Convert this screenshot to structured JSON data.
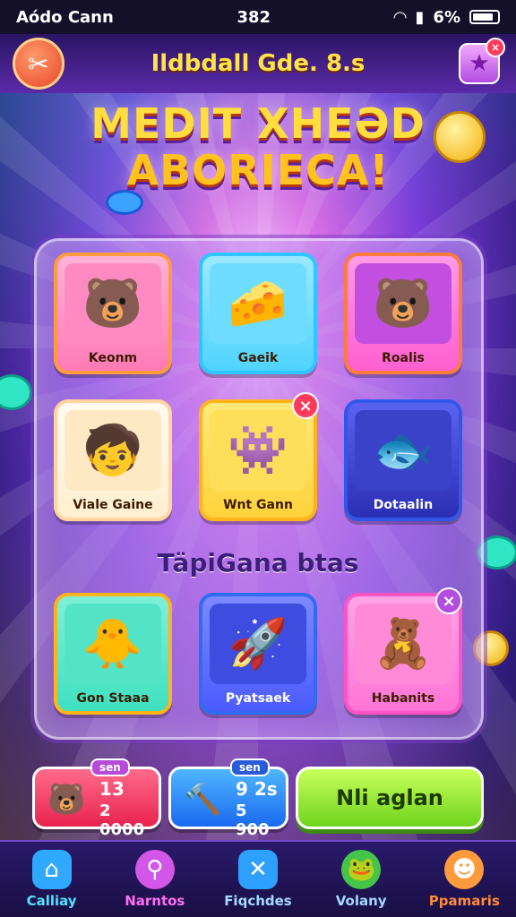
{
  "status_bar": {
    "carrier": "Aódo Cann",
    "time": "382",
    "battery": "6%"
  },
  "header": {
    "title": "Ildbdall Gde. 8.s"
  },
  "hero_title": {
    "line1": "MEDIT XHEƏD",
    "line2": "ABORIECA!"
  },
  "grid_top": [
    {
      "label": "Keonm",
      "icon": "sunglasses-bear-icon",
      "bg": "#ff7ab6",
      "border": "#ff9a3d"
    },
    {
      "label": "Gaeik",
      "icon": "cheese-cake-icon",
      "bg": "#4fd4ff",
      "border": "#2ec6ff"
    },
    {
      "label": "Roalis",
      "icon": "bear-chef-icon",
      "bg": "#ff5fd0",
      "border": "#ff7a3d"
    },
    {
      "label": "Viale Gaine",
      "icon": "helmet-kid-icon",
      "bg": "#fff6e0",
      "border": "#ffd4a0"
    },
    {
      "label": "Wnt Gann",
      "icon": "pink-monster-icon",
      "bg": "#ffd23a",
      "border": "#ffb31a"
    },
    {
      "label": "Dotaalin",
      "icon": "golden-fish-icon",
      "bg": "#3b3fd1",
      "border": "#3057e8"
    }
  ],
  "section_title": "TäpiGana btas",
  "grid_bottom": [
    {
      "label": "Gon Staaa",
      "icon": "yellow-bird-icon",
      "bg": "#3ee0c0",
      "border": "#ffb31a"
    },
    {
      "label": "Pyatsaek",
      "icon": "red-rocket-icon",
      "bg": "#4c5bff",
      "border": "#2f6cf0"
    },
    {
      "label": "Habanits",
      "icon": "purple-bear-icon",
      "bg": "#ff74d6",
      "border": "#ff52c4"
    }
  ],
  "stats": [
    {
      "tag": "sen",
      "line1": "13",
      "line2": "2 0000",
      "icon": "bear-avatar-icon"
    },
    {
      "tag": "sen",
      "line1": "9 2s",
      "line2": "5 900",
      "icon": "hammer-icon"
    }
  ],
  "play_button": {
    "label": "Nli aglan"
  },
  "nav": [
    {
      "label": "Calliay",
      "icon": "home-icon",
      "color": "#4fe4ff"
    },
    {
      "label": "Narntos",
      "icon": "search-icon",
      "color": "#ff6ff0"
    },
    {
      "label": "Fiqchdes",
      "icon": "close-icon",
      "color": "#a4d8ff"
    },
    {
      "label": "Volany",
      "icon": "frog-icon",
      "color": "#a4d8ff"
    },
    {
      "label": "Ppamaris",
      "icon": "orange-blob-icon",
      "color": "#ff8a3d"
    }
  ],
  "colors": {
    "accent": "#ffe34a",
    "panel": "#ba8cf0",
    "play": "#6fd41c"
  }
}
